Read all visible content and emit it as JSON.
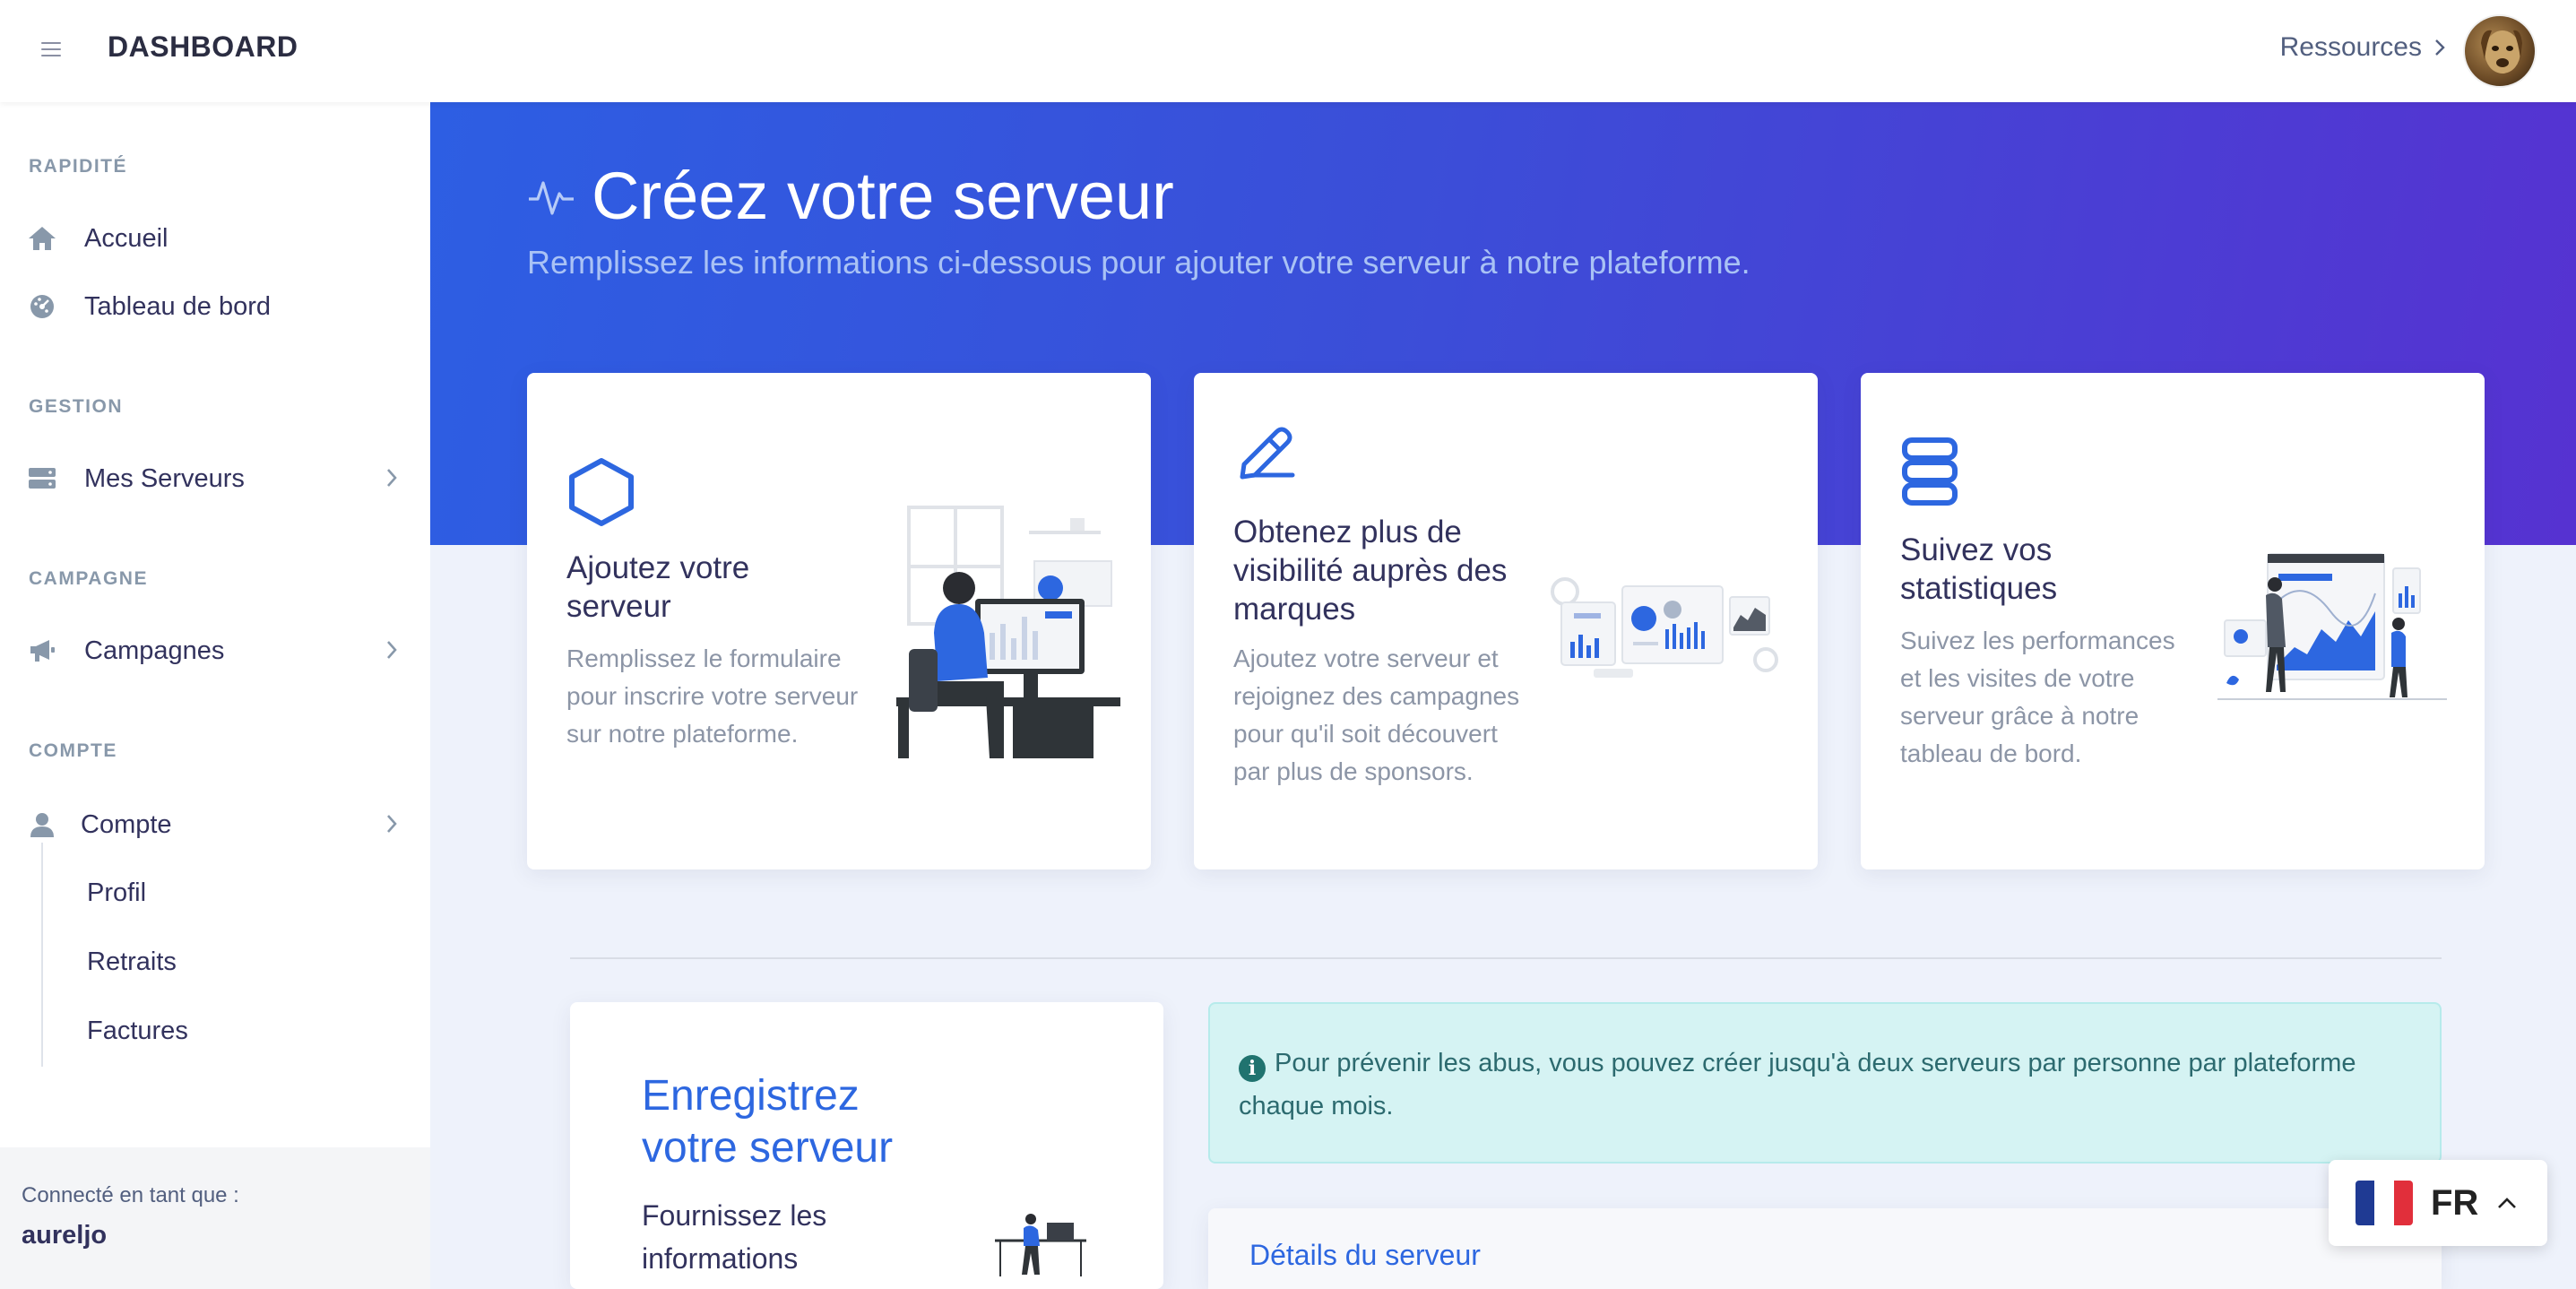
{
  "topbar": {
    "brand": "DASHBOARD",
    "resources_label": "Ressources"
  },
  "sidebar": {
    "sections": {
      "rapidite": "RAPIDITÉ",
      "gestion": "GESTION",
      "campagne": "CAMPAGNE",
      "compte": "COMPTE"
    },
    "items": {
      "accueil": "Accueil",
      "tableau": "Tableau de bord",
      "serveurs": "Mes Serveurs",
      "campagnes": "Campagnes",
      "compte": "Compte"
    },
    "subitems": {
      "profil": "Profil",
      "retraits": "Retraits",
      "factures": "Factures"
    },
    "user": {
      "label": "Connecté en tant que :",
      "name": "aureljo"
    }
  },
  "hero": {
    "title": "Créez votre serveur",
    "subtitle": "Remplissez les informations ci-dessous pour ajouter votre serveur à notre plateforme."
  },
  "cards": [
    {
      "title": "Ajoutez votre serveur",
      "description": "Remplissez le formulaire pour inscrire votre serveur sur notre plateforme.",
      "icon": "hexagon-icon"
    },
    {
      "title": "Obtenez plus de visibilité auprès des marques",
      "description": "Ajoutez votre serveur et rejoignez des campagnes pour qu'il soit découvert par plus de sponsors.",
      "icon": "pen-icon"
    },
    {
      "title": "Suivez vos statistiques",
      "description": "Suivez les performances et les visites de votre serveur grâce à notre tableau de bord.",
      "icon": "database-icon"
    }
  ],
  "register": {
    "title": "Enregistrez votre serveur",
    "text": "Fournissez les informations"
  },
  "alert": {
    "text": "Pour prévenir les abus, vous pouvez créer jusqu'à deux serveurs par personne par plateforme chaque mois."
  },
  "details": {
    "title": "Détails du serveur"
  },
  "language": {
    "code": "FR"
  },
  "colors": {
    "accent": "#2d67e0",
    "hero_start": "#2d5ee3",
    "hero_end": "#5632d1",
    "alert_bg": "#d5f3f3"
  }
}
